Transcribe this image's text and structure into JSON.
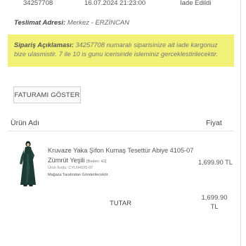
{
  "order": {
    "number": "34257708",
    "date": "16.07.2024 21:23:00",
    "status": "İade Edildi"
  },
  "delivery": {
    "label": "Teslimat Adresi:",
    "value": "Merkez - ERZİNCAN"
  },
  "note": {
    "label": "Sipariş Açıklaması:",
    "text": "34257708 numaralı siparisinize ait iade kargonuz bize ulasmistir. 7 ile 10 is gunu icerisinde isleminiz gerceklestirilecektir.",
    "bg_color": "#f1f177"
  },
  "invoice_button": "FATURAMI GÖSTER",
  "table": {
    "product_header": "Ürün Adı",
    "price_header": "Fiyat"
  },
  "product": {
    "name": "Kruvaze Yaka Şifon Kumaş Tesettür Abiye 4105-07",
    "color": "Zümrüt Yeşili",
    "size": "[Beden: 42]",
    "code": "Ürün Kodu: CYLN4105-07",
    "seller": "Mağaza Tarafından Gönderilecektir.",
    "price": "1,699.90 TL",
    "image_icon": "dress-thumbnail"
  },
  "total": {
    "label": "TUTAR",
    "amount": "1,699.90",
    "currency": "TL"
  }
}
